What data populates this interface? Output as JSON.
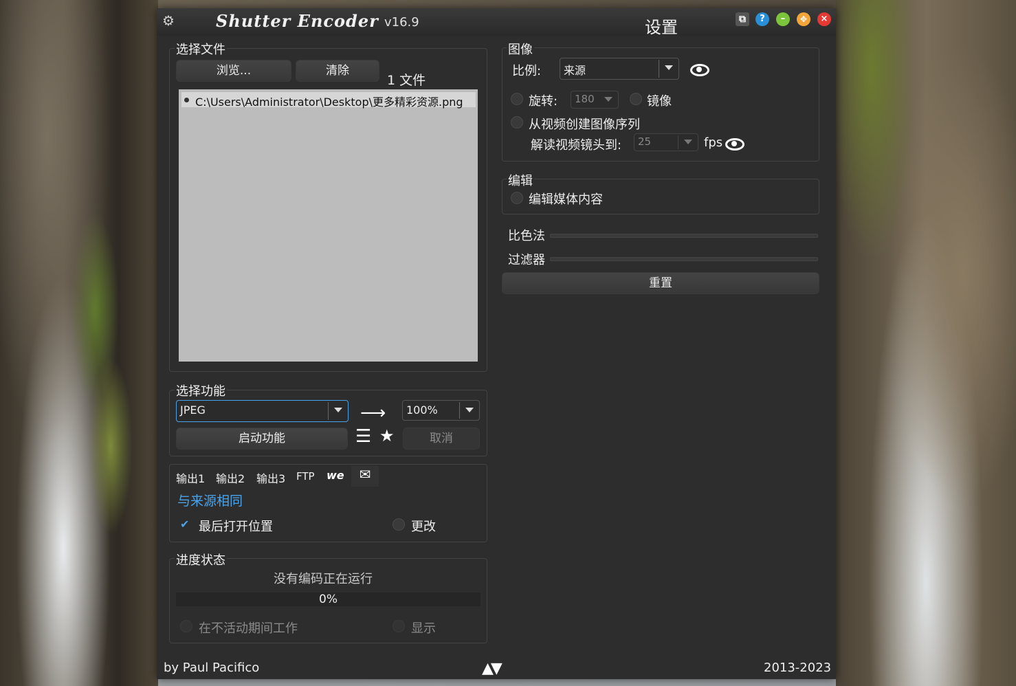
{
  "titlebar": {
    "app_name": "Shutter Encoder",
    "version": "v16.9",
    "settings_title": "设置"
  },
  "files": {
    "section_label": "选择文件",
    "browse_label": "浏览...",
    "clear_label": "清除",
    "count_label": "1 文件",
    "items": [
      "C:\\Users\\Administrator\\Desktop\\更多精彩资源.png"
    ]
  },
  "function": {
    "section_label": "选择功能",
    "selected": "JPEG",
    "percent": "100%",
    "start_label": "启动功能",
    "cancel_label": "取消"
  },
  "output": {
    "tabs": [
      "输出1",
      "输出2",
      "输出3",
      "FTP"
    ],
    "destination": "与来源相同",
    "open_last_label": "最后打开位置",
    "change_label": "更改"
  },
  "progress": {
    "section_label": "进度状态",
    "status": "没有编码正在运行",
    "percent_text": "0%",
    "value": 0,
    "idle_label": "在不活动期间工作",
    "show_label": "显示"
  },
  "image": {
    "section_label": "图像",
    "ratio_label": "比例:",
    "ratio_value": "来源",
    "rotate_label": "旋转:",
    "rotate_value": "180",
    "mirror_label": "镜像",
    "sequence_label": "从视频创建图像序列",
    "decode_label": "解读视频镜头到:",
    "fps_value": "25",
    "fps_label": "fps"
  },
  "edit": {
    "section_label": "编辑",
    "edit_media_label": "编辑媒体内容"
  },
  "colorimetry": {
    "label": "比色法"
  },
  "filters": {
    "label": "过滤器"
  },
  "reset_label": "重置",
  "footer": {
    "author": "by Paul Pacifico",
    "years": "2013-2023"
  },
  "colors": {
    "accent_blue": "#4aa3e8",
    "window_bg": "#2d2d2d",
    "close_red": "#e53935",
    "minimize_green": "#7cc43c",
    "maximize_orange": "#f2a53a",
    "help_blue": "#2b8fd8"
  }
}
